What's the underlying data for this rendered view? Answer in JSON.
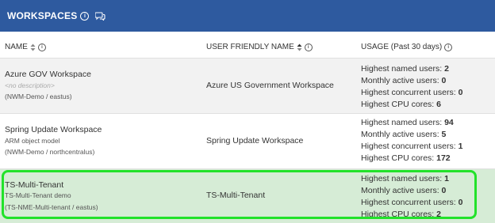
{
  "header": {
    "title": "WORKSPACES",
    "info_icon": "info-icon",
    "chat_icon": "chat-icon",
    "background": "#2e5a9f"
  },
  "columns": {
    "name": "NAME",
    "friendly": "USER FRIENDLY NAME",
    "usage": "USAGE (Past 30 days)"
  },
  "usage_labels": {
    "named": "Highest named users: ",
    "monthly": "Monthly active users: ",
    "concurrent": "Highest concurrent users: ",
    "cpu": "Highest CPU cores: "
  },
  "rows": [
    {
      "name": "Azure GOV Workspace",
      "description": "<no description>",
      "location": "(NWM-Demo / eastus)",
      "friendly": "Azure US Government Workspace",
      "named": "2",
      "monthly": "0",
      "concurrent": "0",
      "cpu": "6"
    },
    {
      "name": "Spring Update Workspace",
      "description": "ARM object model",
      "location": "(NWM-Demo / northcentralus)",
      "friendly": "Spring Update Workspace",
      "named": "94",
      "monthly": "5",
      "concurrent": "1",
      "cpu": "172"
    },
    {
      "name": "TS-Multi-Tenant",
      "description": "TS-Multi-Tenant demo",
      "location": "(TS-NME-Multi-tenant / eastus)",
      "friendly": "TS-Multi-Tenant",
      "named": "1",
      "monthly": "0",
      "concurrent": "0",
      "cpu": "2",
      "selected": true
    }
  ],
  "colors": {
    "selected_row": "#d6ecd6",
    "highlight_border": "#22e22a",
    "alt_row": "#f2f2f2"
  }
}
